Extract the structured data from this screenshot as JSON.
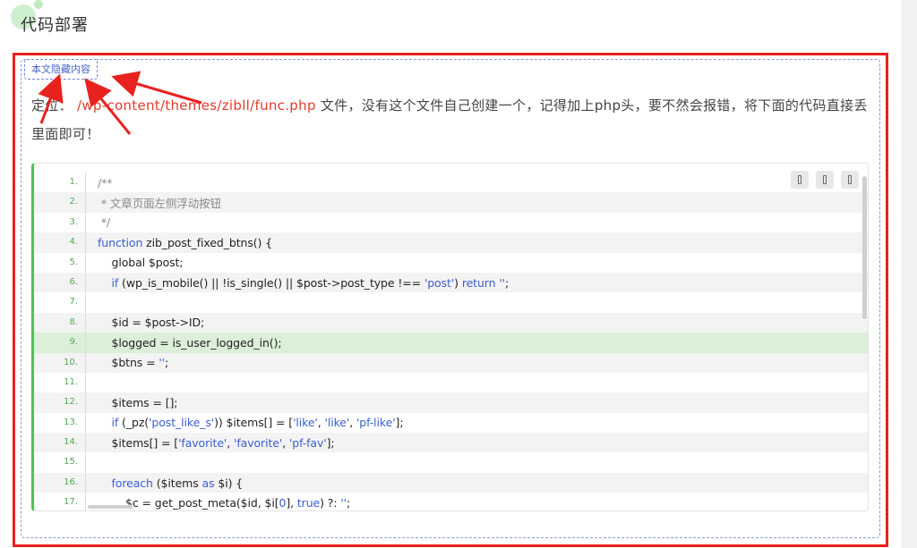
{
  "section": {
    "title": "代码部署"
  },
  "hidden_content": {
    "badge_label": "本文隐藏内容"
  },
  "paragraph": {
    "prefix": "定位：",
    "path": "/wp-content/themes/zibll/func.php",
    "suffix": " 文件，没有这个文件自己创建一个，记得加上php头，要不然会报错，将下面的代码直接丢里面即可！"
  },
  "code": {
    "toolbar_icons": [
      "copy-icon",
      "copy-icon",
      "copy-icon"
    ],
    "highlighted_line": 9,
    "lines": [
      {
        "n": "1.",
        "t": "/**"
      },
      {
        "n": "2.",
        "t": " * 文章页面左侧浮动按钮"
      },
      {
        "n": "3.",
        "t": " */"
      },
      {
        "n": "4.",
        "t": "function zib_post_fixed_btns() {"
      },
      {
        "n": "5.",
        "t": "    global $post;"
      },
      {
        "n": "6.",
        "t": "    if (wp_is_mobile() || !is_single() || $post->post_type !== 'post') return '';"
      },
      {
        "n": "7.",
        "t": ""
      },
      {
        "n": "8.",
        "t": "    $id = $post->ID;"
      },
      {
        "n": "9.",
        "t": "    $logged = is_user_logged_in();"
      },
      {
        "n": "10.",
        "t": "    $btns = '';"
      },
      {
        "n": "11.",
        "t": ""
      },
      {
        "n": "12.",
        "t": "    $items = [];"
      },
      {
        "n": "13.",
        "t": "    if (_pz('post_like_s')) $items[] = ['like', 'like', 'pf-like'];"
      },
      {
        "n": "14.",
        "t": "    $items[] = ['favorite', 'favorite', 'pf-fav'];"
      },
      {
        "n": "15.",
        "t": ""
      },
      {
        "n": "16.",
        "t": "    foreach ($items as $i) {"
      },
      {
        "n": "17.",
        "t": "        $c = get_post_meta($id, $i[0], true) ?: '';"
      }
    ]
  },
  "colors": {
    "accent_red": "#e8221f",
    "code_green": "#4ac651",
    "keyword_blue": "#3b5fcf"
  }
}
